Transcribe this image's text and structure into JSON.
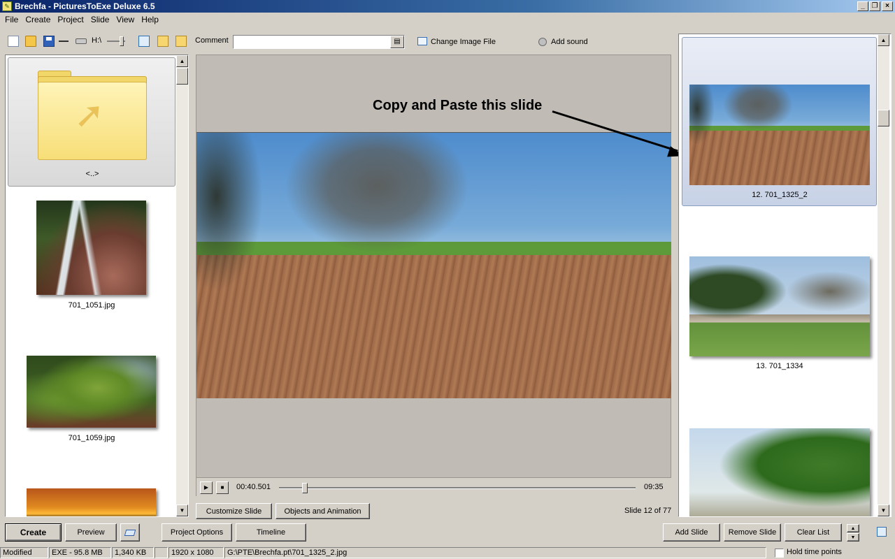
{
  "window": {
    "title": "Brechfa - PicturesToExe Deluxe 6.5",
    "controls": [
      "_",
      "❐",
      "×"
    ]
  },
  "menu": [
    "File",
    "Create",
    "Project",
    "Slide",
    "View",
    "Help"
  ],
  "toolbar": {
    "drive_label": "H:\\",
    "comment_label": "Comment",
    "comment_value": "",
    "change_image_label": "Change Image File",
    "add_sound_label": "Add sound"
  },
  "left_panel": {
    "folder_label": "<..>",
    "files": [
      "701_1051.jpg",
      "701_1059.jpg"
    ]
  },
  "preview": {
    "annotation": "Copy and Paste this slide",
    "current_time": "00:40.501",
    "total_time": "09:35",
    "position_fraction": 0.066
  },
  "center_buttons": {
    "customize": "Customize Slide",
    "objects": "Objects and Animation",
    "slide_counter": "Slide 12 of 77"
  },
  "slides": [
    {
      "label": "12. 701_1325_2",
      "selected": true
    },
    {
      "label": "13. 701_1334",
      "selected": false
    },
    {
      "label": "",
      "selected": false
    }
  ],
  "bottom_buttons": {
    "create": "Create",
    "preview": "Preview",
    "project_options": "Project Options",
    "timeline": "Timeline",
    "add_slide": "Add Slide",
    "remove_slide": "Remove Slide",
    "clear_list": "Clear List"
  },
  "status": {
    "state": "Modified",
    "exe_size": "EXE - 95.8 MB",
    "file_size": "1,340 KB",
    "blank": "",
    "dimensions": "1920 x 1080",
    "path": "G:\\PTE\\Brechfa.pt\\701_1325_2.jpg",
    "hold_time_points": "Hold time points"
  }
}
